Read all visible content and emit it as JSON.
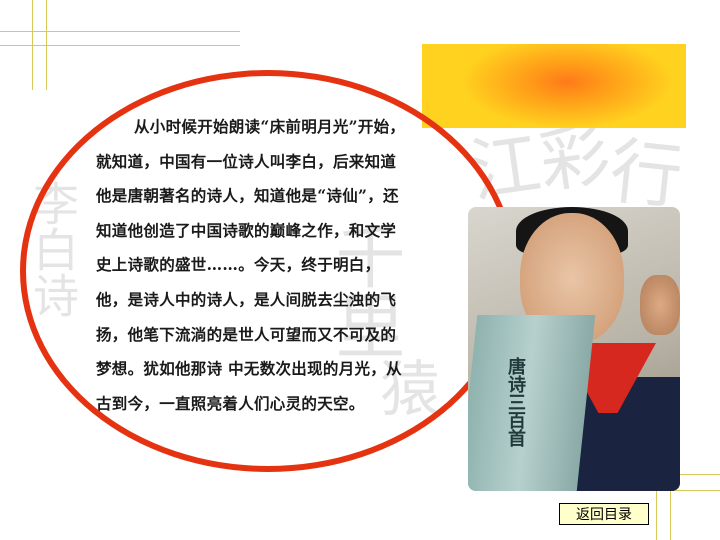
{
  "body_text": {
    "lines": [
      "从小时候开始朗读“床前明月光”开始，",
      "就知道，中国有一位诗人叫李白，后来知道",
      "他是唐朝著名的诗人，知道他是“诗仙”，还",
      "知道他创造了中国诗歌的巅峰之作，和文学",
      "史上诗歌的盛世……。今天，终于明白，",
      "他，是诗人中的诗人，是人间脱去尘浊的飞",
      "扬，他笔下流淌的是世人可望而又不可及的",
      "梦想。犹如他那诗 中无数次出现的月光，从",
      "古到今，一直照亮着人们心灵的天空。"
    ]
  },
  "photo": {
    "book_title": "唐诗三百首"
  },
  "navigation": {
    "back_label": "返回目录"
  },
  "colors": {
    "ring": "#e53312",
    "grid_lines": "#d7c95b",
    "button_bg": "#ffffcc"
  }
}
